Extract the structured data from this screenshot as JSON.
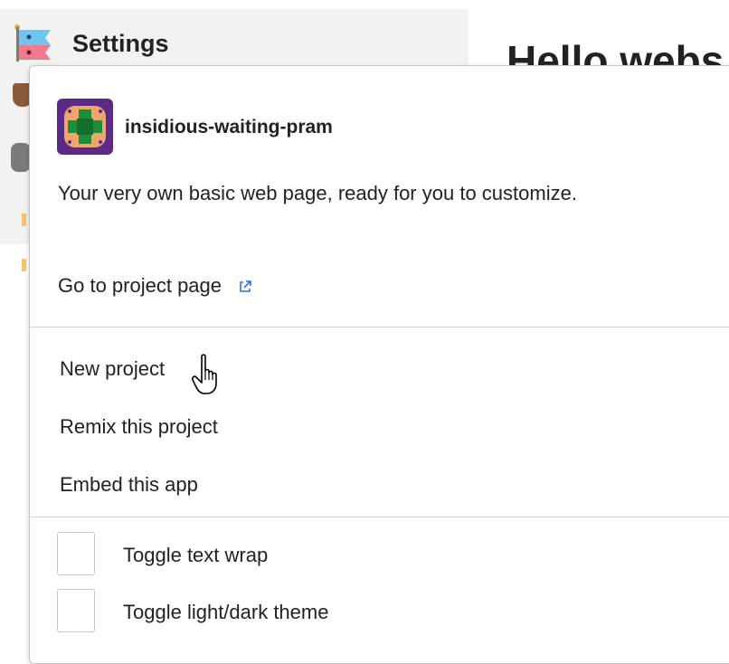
{
  "app": {
    "settings_title": "Settings",
    "preview_heading": "Hello webs"
  },
  "popup": {
    "project_name": "insidious-waiting-pram",
    "description": "Your very own basic web page, ready for you to customize.",
    "project_link_label": "Go to project page",
    "menu_items": [
      {
        "label": "New project"
      },
      {
        "label": "Remix this project"
      },
      {
        "label": "Embed this app"
      }
    ],
    "toggles": [
      {
        "label": "Toggle text wrap",
        "checked": false
      },
      {
        "label": "Toggle light/dark theme",
        "checked": false
      }
    ]
  },
  "colors": {
    "avatar_bg": "#5b2a86",
    "avatar_inner": "#f0a56b",
    "avatar_cross": "#1e8c3a",
    "link_icon": "#2f6fe0"
  },
  "icons": {
    "settings_logo": "glitch-fish-logo-icon",
    "project_avatar": "project-avatar-icon",
    "external_link": "external-link-icon",
    "pointer_cursor": "hand-pointer-cursor-icon"
  }
}
